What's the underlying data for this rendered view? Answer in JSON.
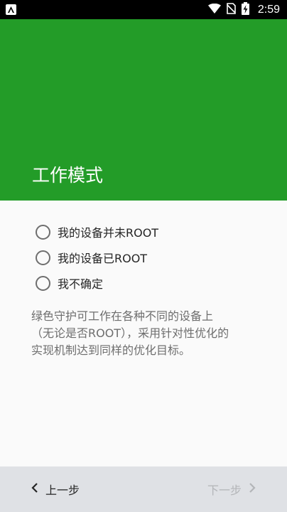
{
  "status_bar": {
    "time": "2:59",
    "icons": [
      "app-notification-icon",
      "wifi-icon",
      "no-sim-icon",
      "battery-charging-icon"
    ]
  },
  "header": {
    "title": "工作模式",
    "color": "#239c28"
  },
  "options": [
    {
      "label": "我的设备并未ROOT",
      "selected": false
    },
    {
      "label": "我的设备已ROOT",
      "selected": false
    },
    {
      "label": "我不确定",
      "selected": false
    }
  ],
  "description": {
    "line1": "绿色守护可工作在各种不同的设备上",
    "line2": "（无论是否ROOT），采用针对性优化的",
    "line3": "实现机制达到同样的优化目标。"
  },
  "footer": {
    "prev_label": "上一步",
    "next_label": "下一步",
    "next_enabled": false
  }
}
